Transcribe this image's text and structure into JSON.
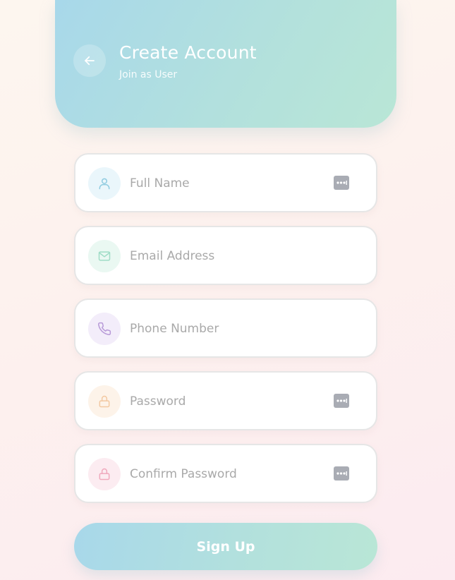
{
  "header": {
    "title": "Create Account",
    "subtitle": "Join as User",
    "back_icon": "arrow-left-icon"
  },
  "fields": [
    {
      "placeholder": "Full Name",
      "icon": "user-icon",
      "icon_color": "#8fcbe0",
      "icon_bg": "#eaf6fb",
      "has_badge": true
    },
    {
      "placeholder": "Email Address",
      "icon": "mail-icon",
      "icon_color": "#9fdcc6",
      "icon_bg": "#eaf8f2",
      "has_badge": false
    },
    {
      "placeholder": "Phone Number",
      "icon": "phone-icon",
      "icon_color": "#b89ad8",
      "icon_bg": "#f3edfa",
      "has_badge": false
    },
    {
      "placeholder": "Password",
      "icon": "lock-icon",
      "icon_color": "#f3c9a2",
      "icon_bg": "#fdf3e9",
      "has_badge": true
    },
    {
      "placeholder": "Confirm Password",
      "icon": "lock-icon",
      "icon_color": "#f0a9bd",
      "icon_bg": "#fcecf1",
      "has_badge": true
    }
  ],
  "badge": {
    "icon": "password-manager-icon",
    "color": "#a9acb4"
  },
  "signup": {
    "label": "Sign Up"
  },
  "colors": {
    "accent_start": "#a8d8ea",
    "accent_end": "#b9e6d6"
  }
}
